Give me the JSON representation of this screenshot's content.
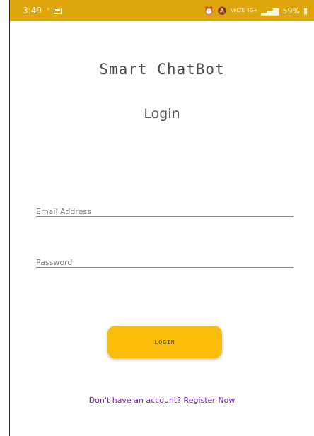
{
  "status_bar": {
    "time": "3:49",
    "notif_small": "°",
    "network_label": "VoLTE 4G+",
    "battery": "59%"
  },
  "app": {
    "title": "Smart ChatBot",
    "screen_title": "Login"
  },
  "form": {
    "email_placeholder": "Email Address",
    "password_placeholder": "Password",
    "login_label": "LOGIN",
    "register_link": "Don't have an account? Register Now"
  },
  "colors": {
    "status_bar": "#dda60d",
    "button": "#fbbc0a",
    "link": "#6a1f9a"
  }
}
